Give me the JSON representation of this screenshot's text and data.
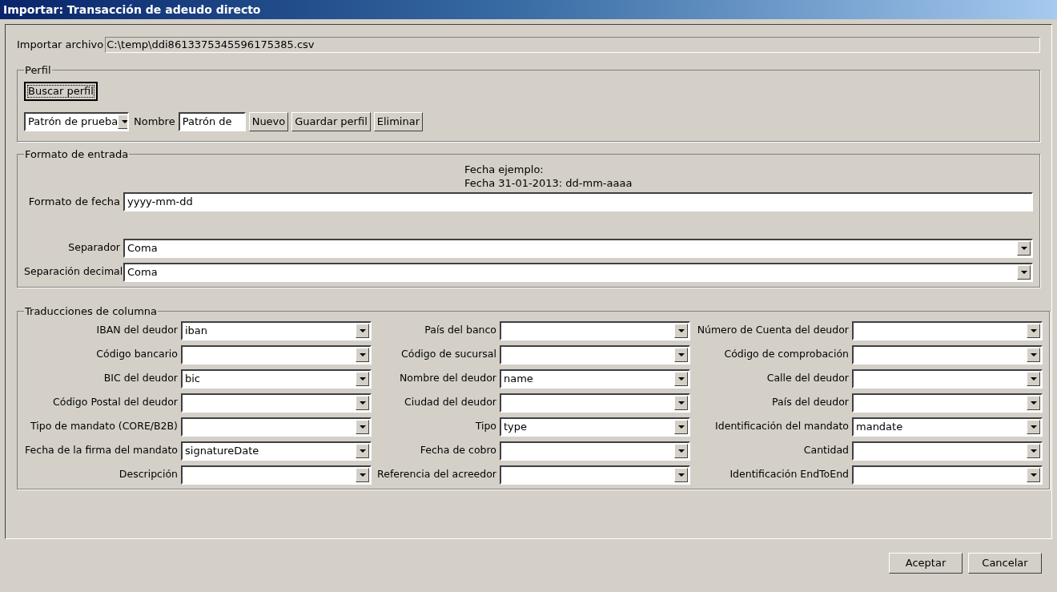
{
  "window": {
    "title": "Importar: Transacción de adeudo directo"
  },
  "import_file": {
    "label": "Importar archivo",
    "value": "C:\\temp\\ddi8613375345596175385.csv"
  },
  "profile": {
    "legend": "Perfil",
    "search_button": {
      "label": "Buscar perfil",
      "focused": true
    },
    "profile_select": {
      "value": "Patrón de prueba"
    },
    "name_label": "Nombre",
    "name_field": {
      "value": "Patrón de"
    },
    "buttons": [
      {
        "label": "Nuevo",
        "focused": false
      },
      {
        "label": "Guardar perfil",
        "focused": false
      },
      {
        "label": "Eliminar",
        "focused": false
      }
    ]
  },
  "input_format": {
    "legend": "Formato de entrada",
    "example_lines": [
      "Fecha ejemplo:",
      "Fecha 31-01-2013: dd-mm-aaaa"
    ],
    "date_format": {
      "label": "Formato de fecha",
      "value": "yyyy-mm-dd"
    },
    "selects": [
      {
        "label": "Separador",
        "value": "Coma"
      },
      {
        "label": "Separación decimal",
        "value": "Coma"
      }
    ]
  },
  "column_translations": {
    "legend": "Traducciones de columna",
    "fields": [
      {
        "label": "IBAN del deudor",
        "value": "iban"
      },
      {
        "label": "País del banco"
      },
      {
        "label": "Número de Cuenta del deudor"
      },
      {
        "label": "Código bancario"
      },
      {
        "label": "Código de sucursal"
      },
      {
        "label": "Código de comprobación"
      },
      {
        "label": "BIC del deudor",
        "value": "bic"
      },
      {
        "label": "Nombre del deudor",
        "value": "name"
      },
      {
        "label": "Calle del deudor"
      },
      {
        "label": "Código Postal del deudor"
      },
      {
        "label": "Ciudad del deudor"
      },
      {
        "label": "País del deudor"
      },
      {
        "label": "Tipo de mandato (CORE/B2B)"
      },
      {
        "label": "Tipo",
        "value": "type"
      },
      {
        "label": "Identificación del mandato",
        "value": "mandate"
      },
      {
        "label": "Fecha de la firma del mandato",
        "value": "signatureDate"
      },
      {
        "label": "Fecha de cobro"
      },
      {
        "label": "Cantidad"
      },
      {
        "label": "Descripción"
      },
      {
        "label": "Referencia del acreedor"
      },
      {
        "label": "Identificación EndToEnd"
      }
    ]
  },
  "dialog_buttons": [
    "Aceptar",
    "Cancelar"
  ]
}
